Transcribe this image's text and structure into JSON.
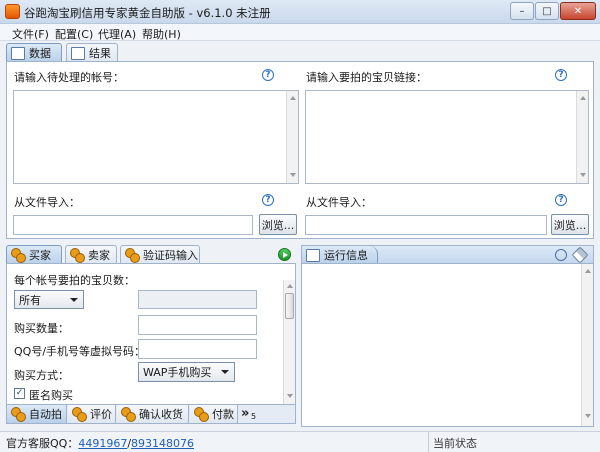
{
  "window": {
    "title": "谷跑淘宝刷信用专家黄金自助版 - v6.1.0 未注册",
    "minimize": "–",
    "maximize": "□",
    "close": "✕"
  },
  "menu": [
    {
      "label": "文件(F)"
    },
    {
      "label": "配置(C)"
    },
    {
      "label": "代理(A)"
    },
    {
      "label": "帮助(H)"
    }
  ],
  "main_tabs": [
    {
      "label": "数据",
      "active": true
    },
    {
      "label": "结果",
      "active": false
    }
  ],
  "data_panel": {
    "accounts_label": "请输入待处理的帐号：",
    "links_label": "请输入要拍的宝贝链接：",
    "import_label_left": "从文件导入：",
    "import_label_right": "从文件导入：",
    "browse_left": "浏览...",
    "browse_right": "浏览...",
    "help": "?"
  },
  "role_tabs": [
    {
      "label": "买家",
      "active": true
    },
    {
      "label": "卖家",
      "active": false
    },
    {
      "label": "验证码输入",
      "active": false
    }
  ],
  "buyer_form": {
    "items_per_account_label": "每个帐号要拍的宝贝数：",
    "items_select": "所有",
    "quantity_label": "购买数量：",
    "qq_label": "QQ号/手机号等虚拟号码：",
    "buy_method_label": "购买方式：",
    "buy_method_select": "WAP手机购买",
    "anonymous_label": "匿名购买",
    "anonymous_checked": true
  },
  "bottom_tabs": [
    {
      "label": "自动拍",
      "active": true
    },
    {
      "label": "评价",
      "active": false
    },
    {
      "label": "确认收货",
      "active": false
    },
    {
      "label": "付款",
      "active": false
    },
    {
      "label": "»",
      "active": false
    }
  ],
  "bottom_tabs_more_count": "5",
  "run_info": {
    "tab_label": "运行信息"
  },
  "status": {
    "support_label": "官方客服QQ：",
    "qq1": "4491967",
    "separator": "/",
    "qq2": "893148076",
    "right_text": "当前状态"
  }
}
